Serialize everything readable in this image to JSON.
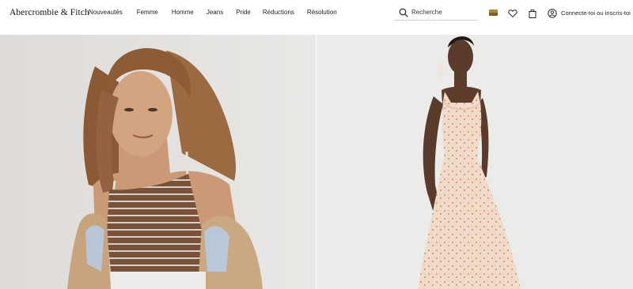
{
  "brand": {
    "logo_text": "Abercrombie & Fitch"
  },
  "nav": {
    "items": [
      "Nouveautés",
      "Femme",
      "Homme",
      "Jeans",
      "Pride",
      "Réductions",
      "Résolution"
    ]
  },
  "search": {
    "placeholder": "Recherche"
  },
  "header_icons": {
    "flag_colors": [
      "#b08a3b",
      "#8a6a2a"
    ],
    "wishlist_icon": "heart-icon",
    "bag_icon": "shopping-bag-icon",
    "account_icon": "user-circle-icon",
    "account_label": "Connecte-toi ou inscris-toi"
  },
  "hero": {
    "left_image": "woman-striped-cami-with-jacket",
    "right_image": "woman-floral-midi-dress"
  }
}
